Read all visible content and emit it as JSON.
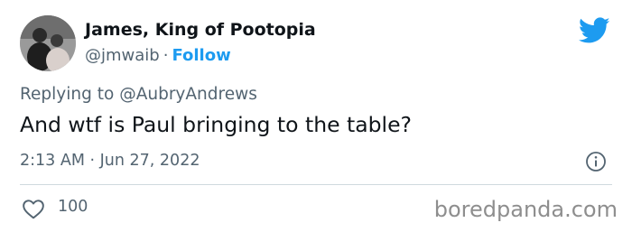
{
  "tweet": {
    "display_name": "James, King of Pootopia",
    "handle": "@jmwaib",
    "separator": "·",
    "follow_label": "Follow",
    "replying_prefix": "Replying to",
    "replying_to": "@AubryAndrews",
    "text": "And wtf is Paul bringing to the table?",
    "timestamp": "2:13 AM · Jun 27, 2022",
    "like_count": "100"
  },
  "icons": {
    "brand": "twitter-bird-icon",
    "info": "info-icon",
    "like": "heart-icon"
  },
  "colors": {
    "accent": "#1d9bf0",
    "text_primary": "#0f1419",
    "text_secondary": "#536471",
    "divider": "#cfd9de"
  },
  "watermark": "boredpanda.com"
}
